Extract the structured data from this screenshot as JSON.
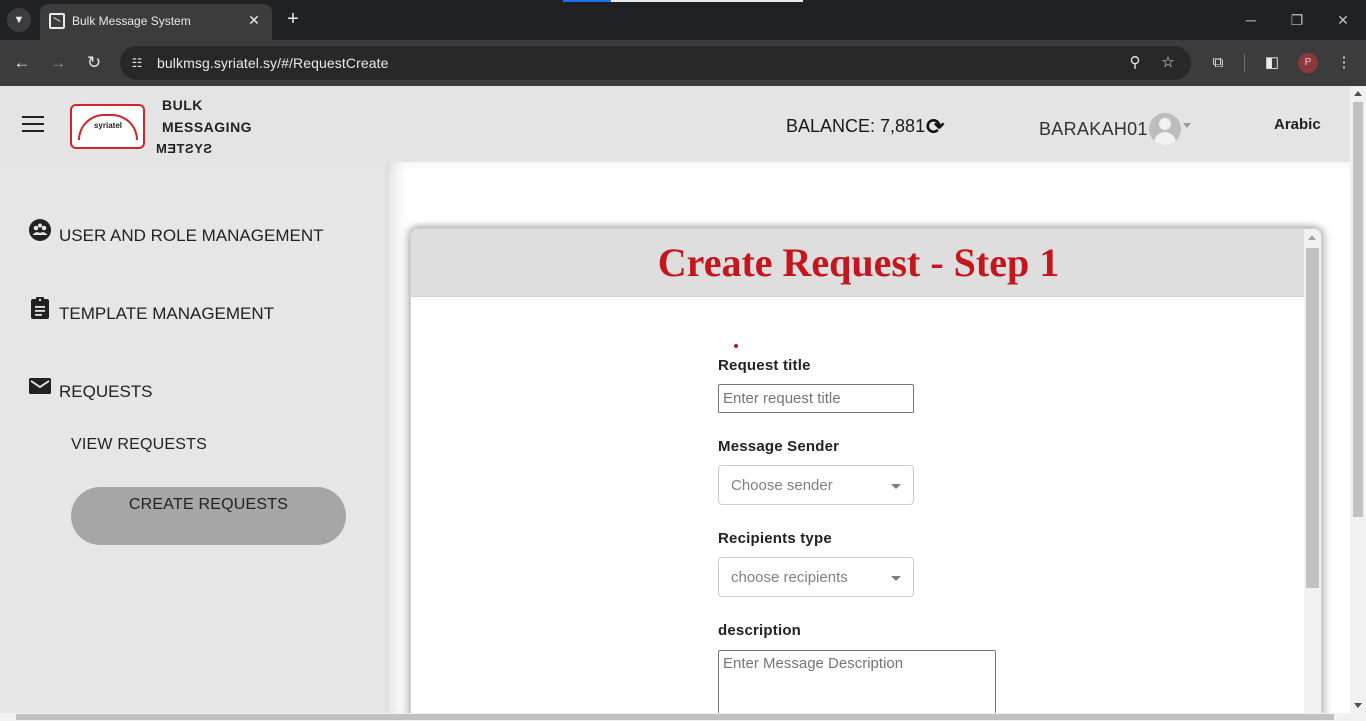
{
  "browser": {
    "tab_title": "Bulk Message System",
    "url": "bulkmsg.syriatel.sy/#/RequestCreate",
    "profile_initial": "P"
  },
  "header": {
    "brand_line1": "BULK",
    "brand_line2": "MESSAGING",
    "brand_line3": "SYSTEM",
    "balance": "BALANCE: 7,881",
    "username": "BARAKAH01",
    "language": "Arabic"
  },
  "sidebar": {
    "items": [
      {
        "label": "USER AND ROLE MANAGEMENT",
        "icon": "account-group-icon"
      },
      {
        "label": "TEMPLATE MANAGEMENT",
        "icon": "clipboard-icon"
      },
      {
        "label": "REQUESTS",
        "icon": "mail-icon"
      }
    ],
    "sub_items": [
      {
        "label": "VIEW REQUESTS"
      },
      {
        "label": "CREATE REQUESTS",
        "active": true
      }
    ]
  },
  "form": {
    "title": "Create Request - Step 1",
    "request_title_label": "Request title",
    "request_title_placeholder": "Enter request title",
    "sender_label": "Message Sender",
    "sender_placeholder": "Choose sender",
    "recipients_label": "Recipients type",
    "recipients_placeholder": "choose recipients",
    "description_label": "description",
    "description_placeholder": "Enter Message Description"
  },
  "colors": {
    "accent_red": "#c4161c",
    "active_item_bg": "#a6a6a6",
    "header_bg": "#e4e4e4"
  }
}
